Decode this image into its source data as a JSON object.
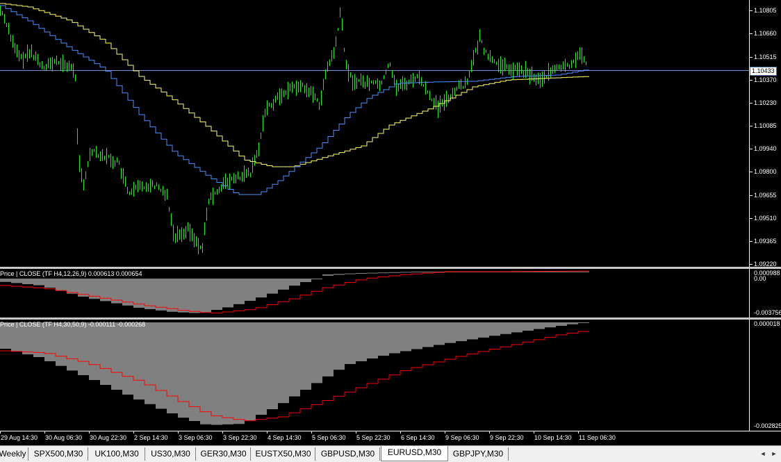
{
  "chart": {
    "price_axis_labels": [
      "1.10805",
      "1.10660",
      "1.10515",
      "1.10370",
      "1.10230",
      "1.10085",
      "1.09940",
      "1.09800",
      "1.09655",
      "1.09510",
      "1.09365",
      "1.09220"
    ],
    "current_price": "1.10433",
    "colors": {
      "bars": "#00ff00",
      "ma_fast": "#4a90ff",
      "ma_slow": "#ffff66",
      "price_line": "#6f8fd0",
      "macd_hist": "#808080",
      "signal": "#ff0000"
    }
  },
  "indicator1": {
    "label": "Price | CLOSE  (TF H4,12,26,9) 0.000613 0.000654",
    "axis_labels": [
      "0.000988",
      "0.00",
      "-0.003756"
    ]
  },
  "indicator2": {
    "label": "Price | CLOSE  (TF H4,30,50,9) -0.000111 -0.000268",
    "axis_labels": [
      "0.000018",
      "-0.002825"
    ]
  },
  "time_axis": {
    "labels": [
      "29 Aug 14:30",
      "30 Aug 06:30",
      "30 Aug 22:30",
      "2 Sep 14:30",
      "3 Sep 06:30",
      "3 Sep 22:30",
      "4 Sep 14:30",
      "5 Sep 06:30",
      "5 Sep 22:30",
      "6 Sep 14:30",
      "9 Sep 06:30",
      "9 Sep 22:30",
      "10 Sep 14:30",
      "11 Sep 06:30"
    ]
  },
  "tabs": {
    "items": [
      "Weekly",
      "SPX500,M30",
      "UK100,M30",
      "US30,M30",
      "GER30,M30",
      "EUSTX50,M30",
      "GBPUSD,M30",
      "EURUSD,M30",
      "GBPJPY,M30"
    ],
    "active": "EURUSD,M30",
    "nav_left": "◄",
    "nav_right": "►"
  }
}
